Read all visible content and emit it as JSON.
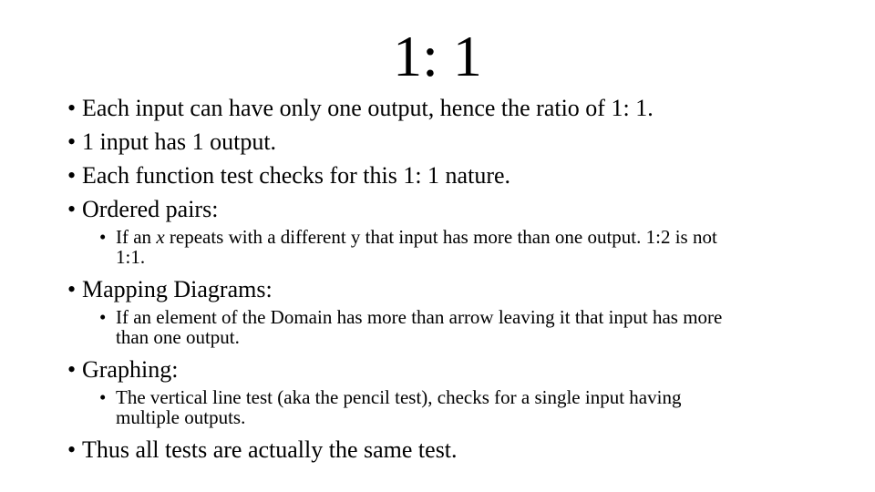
{
  "slide": {
    "title": "1: 1",
    "bullet_glyph": "•",
    "items": [
      {
        "level": 1,
        "text": "Each input can have only one output, hence the ratio of 1: 1."
      },
      {
        "level": 1,
        "text": "1 input has 1 output."
      },
      {
        "level": 1,
        "text": "Each function test checks for this 1: 1 nature."
      },
      {
        "level": 1,
        "text": "Ordered pairs:"
      },
      {
        "level": 2,
        "pre": "If an ",
        "em": "x",
        "post": " repeats with a different y that input has more than one output.  1:2 is not",
        "line2": "1:1."
      },
      {
        "level": 1,
        "text": "Mapping Diagrams:"
      },
      {
        "level": 2,
        "pre": "If an element of the Domain has more than arrow leaving it that input has more",
        "em": "",
        "post": "",
        "line2": "than one output."
      },
      {
        "level": 1,
        "text": "Graphing:"
      },
      {
        "level": 2,
        "pre": "The vertical line test (aka the pencil test), checks for a single input having",
        "em": "",
        "post": "",
        "line2": "multiple outputs."
      },
      {
        "level": 1,
        "text": "Thus all tests are actually the same test."
      }
    ]
  }
}
